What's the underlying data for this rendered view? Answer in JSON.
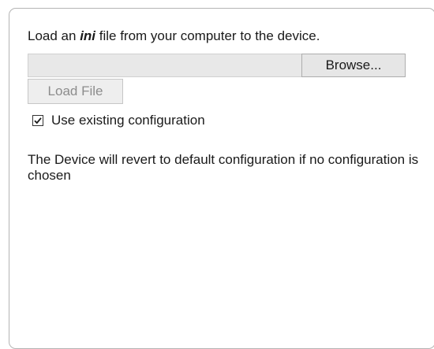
{
  "intro": {
    "before": "Load an ",
    "emphasis": "ini",
    "after": " file from your computer to the device."
  },
  "file_input": {
    "value": "",
    "browse_label": "Browse..."
  },
  "load_button": {
    "label": "Load File",
    "enabled": false
  },
  "use_existing": {
    "label": "Use existing configuration",
    "checked": true
  },
  "note": "The Device will revert to default configuration if no configuration is chosen"
}
